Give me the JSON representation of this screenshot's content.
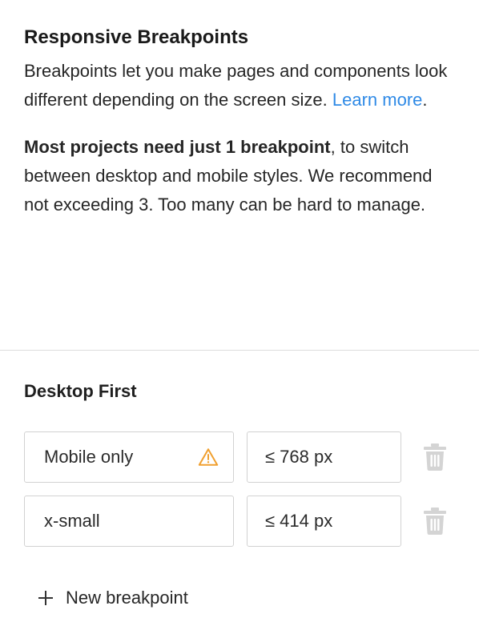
{
  "intro": {
    "title": "Responsive Breakpoints",
    "para1_text": "Breakpoints let you make pages and components look different depending on the screen size. ",
    "para1_link": "Learn more",
    "para1_end": ".",
    "para2_bold": "Most projects need just 1 breakpoint",
    "para2_text": ", to switch between desktop and mobile styles. We recommend not exceeding 3. Too many can be hard to manage."
  },
  "section": {
    "title": "Desktop First"
  },
  "breakpoints": [
    {
      "name": "Mobile only",
      "size": "≤ 768 px",
      "warning": true
    },
    {
      "name": "x-small",
      "size": "≤ 414 px",
      "warning": false
    }
  ],
  "actions": {
    "new_breakpoint": "New breakpoint"
  },
  "colors": {
    "link": "#2f8ae6",
    "warning": "#f0a030",
    "trash": "#d4d4d4"
  },
  "icons": {
    "warning": "warning-icon",
    "trash": "trash-icon",
    "plus": "plus-icon"
  }
}
